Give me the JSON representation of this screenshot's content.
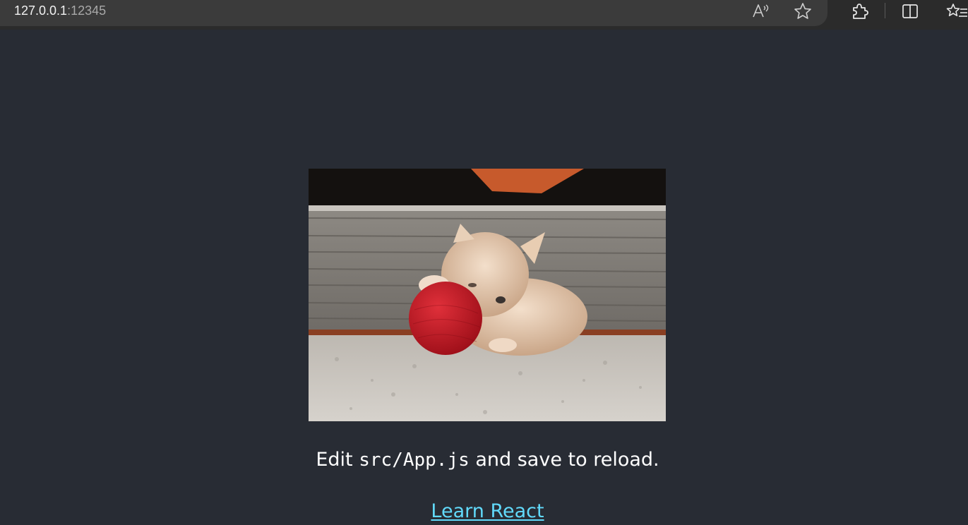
{
  "browser": {
    "address_host": "127.0.0.1",
    "address_port": ":12345",
    "toolbar_icons": [
      "read-aloud-icon",
      "favorite-star-icon",
      "extensions-icon",
      "split-screen-icon",
      "favorites-list-icon"
    ]
  },
  "app": {
    "background": "#282c34",
    "link_color": "#61dafb",
    "edit_prefix": "Edit ",
    "edit_code": "src/App.js",
    "edit_suffix": " and save to reload.",
    "learn_link": "Learn React"
  }
}
